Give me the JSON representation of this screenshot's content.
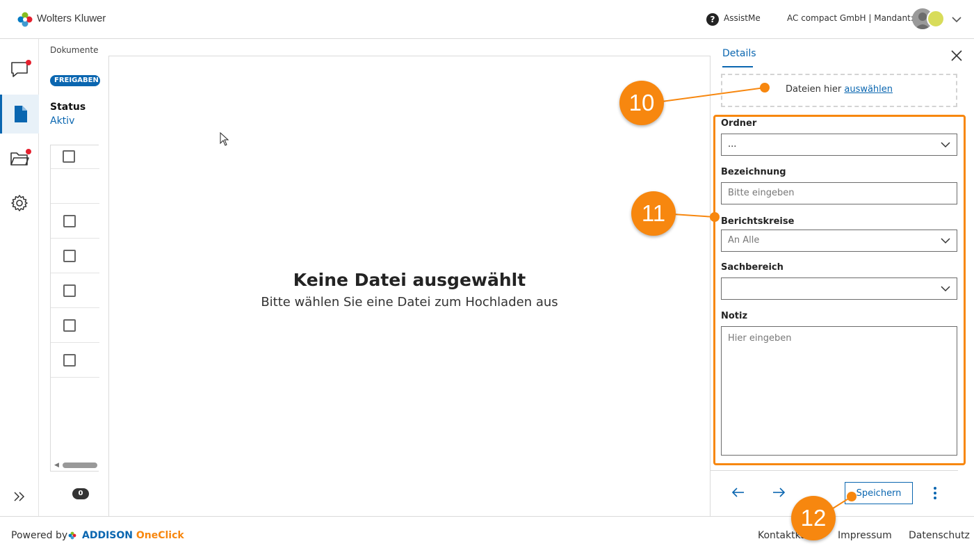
{
  "header": {
    "brand": "Wolters Kluwer",
    "help_glyph": "?",
    "assist": "AssistMe",
    "client": "AC compact GmbH | Mandant: 2"
  },
  "list": {
    "breadcrumb": "Dokumente",
    "badge": "FREIGABEN",
    "status_label": "Status",
    "status_value": "Aktiv",
    "count": "0"
  },
  "preview": {
    "title": "Keine Datei ausgewählt",
    "subtitle": "Bitte wählen Sie eine Datei zum Hochladen aus"
  },
  "panel": {
    "tab": "Details",
    "drop_prefix": "Dateien hier ",
    "drop_link": "auswählen",
    "ordner_label": "Ordner",
    "ordner_value": "...",
    "bezeichnung_label": "Bezeichnung",
    "bezeichnung_placeholder": "Bitte eingeben",
    "berichtskreise_label": "Berichtskreise",
    "berichtskreise_value": "An Alle",
    "sachbereich_label": "Sachbereich",
    "sachbereich_value": "",
    "notiz_label": "Notiz",
    "notiz_placeholder": "Hier eingeben",
    "save": "Speichern"
  },
  "footer": {
    "powered": "Powered by",
    "addison": "ADDISON",
    "oneclick": "OneClick",
    "kontakt": "Kontaktka",
    "impressum": "Impressum",
    "datenschutz": "Datenschutz"
  },
  "callouts": [
    "10",
    "11",
    "12"
  ],
  "colors": {
    "accent": "#0a66b0",
    "callout": "#f7870f",
    "notification": "#e5202e"
  }
}
